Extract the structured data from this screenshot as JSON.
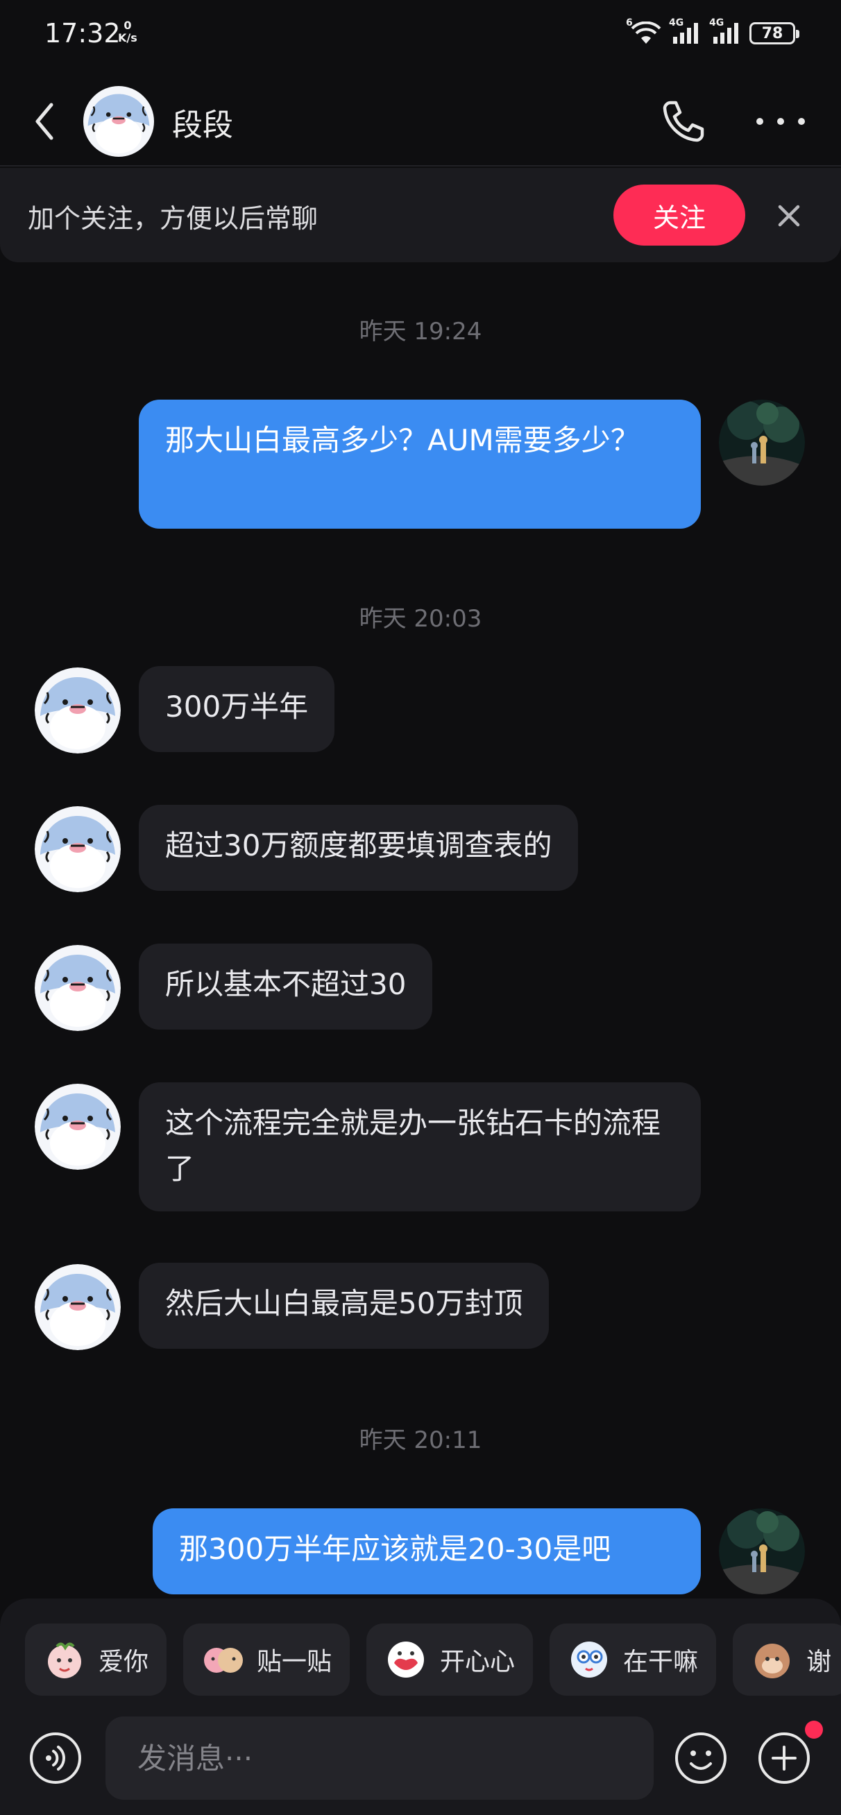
{
  "status_bar": {
    "time": "17:32",
    "net_speed_value": "0",
    "net_speed_unit": "K/s",
    "net_tag_1": "4G",
    "net_tag_2": "4G",
    "wifi_tag": "6",
    "battery": "78"
  },
  "header": {
    "contact_name": "段段",
    "icons": [
      "back-icon",
      "phone-icon",
      "more-icon"
    ]
  },
  "follow_banner": {
    "text": "加个关注，方便以后常聊",
    "button_label": "关注"
  },
  "chat": {
    "timestamps": [
      "昨天 19:24",
      "昨天 20:03",
      "昨天 20:11"
    ],
    "messages": [
      {
        "side": "out",
        "text": "那大山白最高多少？AUM需要多少？"
      },
      {
        "side": "in",
        "text": "300万半年"
      },
      {
        "side": "in",
        "text": "超过30万额度都要填调查表的"
      },
      {
        "side": "in",
        "text": "所以基本不超过30"
      },
      {
        "side": "in",
        "text": "这个流程完全就是办一张钻石卡的流程了"
      },
      {
        "side": "in",
        "text": "然后大山白最高是50万封顶"
      },
      {
        "side": "out",
        "text": "那300万半年应该就是20-30是吧"
      }
    ]
  },
  "quick_replies": [
    {
      "label": "爱你"
    },
    {
      "label": "贴一贴"
    },
    {
      "label": "开心心"
    },
    {
      "label": "在干嘛"
    },
    {
      "label": "谢"
    }
  ],
  "composer": {
    "placeholder": "发消息···"
  },
  "colors": {
    "background": "#0e0e10",
    "incoming_bubble": "#1f1f24",
    "outgoing_bubble": "#3b8cf2",
    "accent_red": "#fe2c55"
  }
}
